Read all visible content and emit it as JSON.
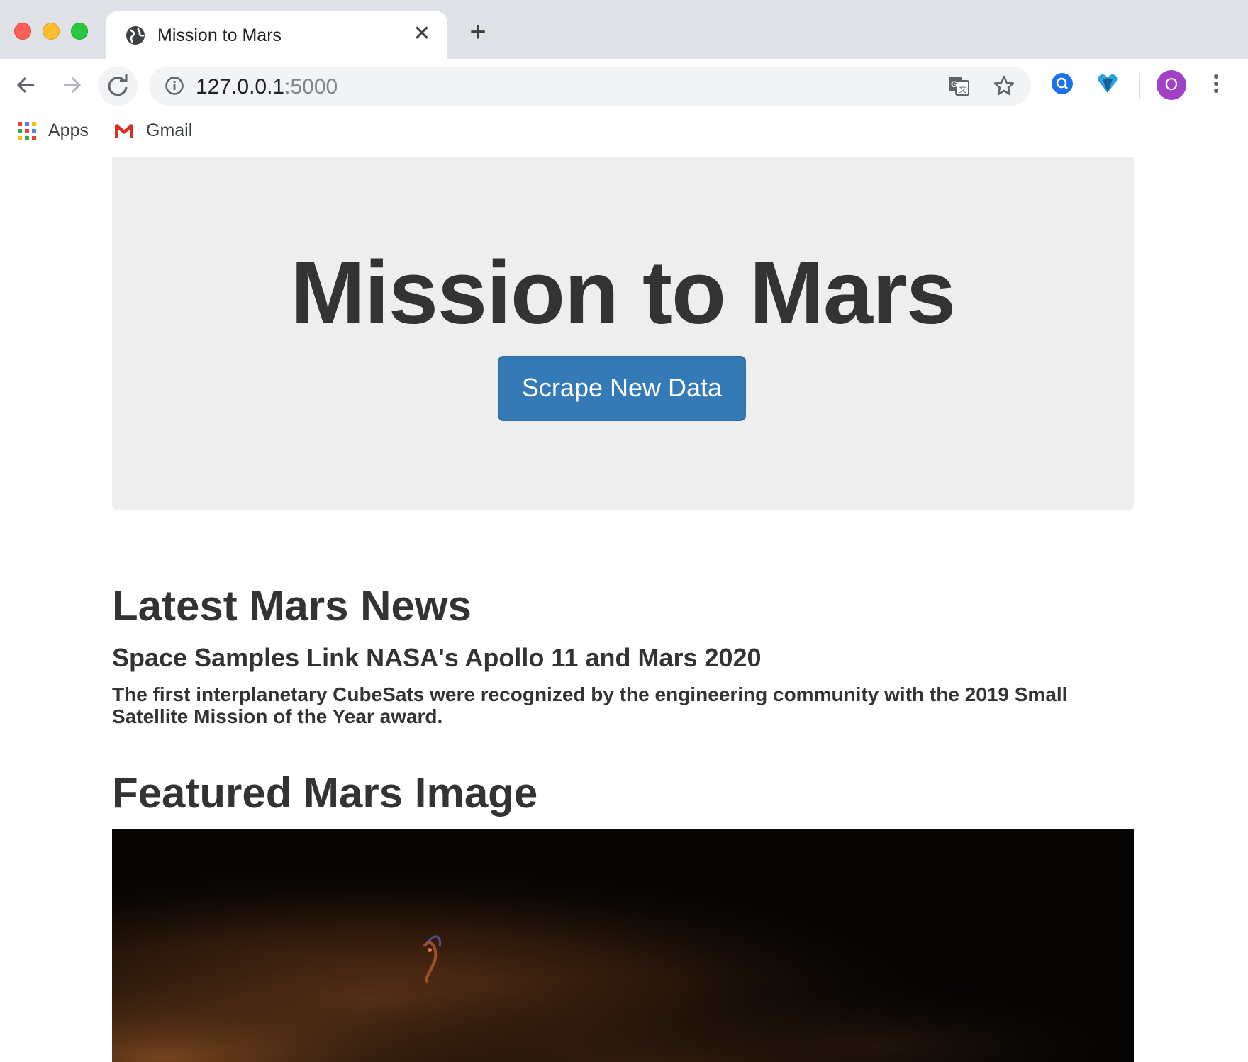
{
  "browser": {
    "tab": {
      "title": "Mission to Mars",
      "close": "✕"
    },
    "new_tab": "+",
    "address": {
      "host": "127.0.0.1",
      "port": ":5000"
    },
    "profile_initial": "O",
    "bookmarks": [
      {
        "label": "Apps",
        "icon": "apps-grid-icon"
      },
      {
        "label": "Gmail",
        "icon": "gmail-icon"
      }
    ]
  },
  "page": {
    "title": "Mission to Mars",
    "scrape_button": "Scrape New Data",
    "news": {
      "heading": "Latest Mars News",
      "title": "Space Samples Link NASA's Apollo 11 and Mars 2020",
      "paragraph": "The first interplanetary CubeSats were recognized by the engineering community with the 2019 Small Satellite Mission of the Year award."
    },
    "featured_image": {
      "heading": "Featured Mars Image"
    }
  },
  "colors": {
    "button_primary": "#337ab7",
    "jumbotron_bg": "#eeeeee",
    "text": "#333333",
    "avatar": "#a142c6"
  }
}
